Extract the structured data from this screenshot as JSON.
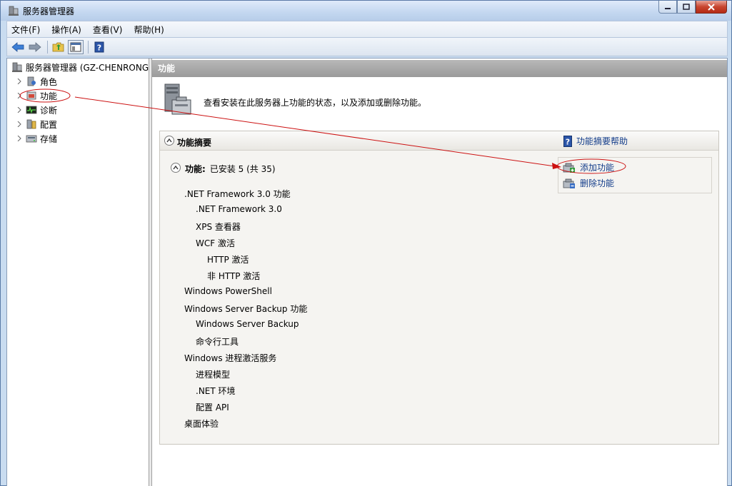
{
  "window": {
    "title": "服务器管理器"
  },
  "menu": [
    "文件(F)",
    "操作(A)",
    "查看(V)",
    "帮助(H)"
  ],
  "toolbar": {
    "icons": [
      "back-arrow-icon",
      "forward-arrow-icon",
      "up-folder-icon",
      "show-hide-pane-icon",
      "help-icon"
    ]
  },
  "tree": {
    "root": "服务器管理器 (GZ-CHENRONG",
    "items": [
      {
        "label": "角色",
        "icon": "roles-icon"
      },
      {
        "label": "功能",
        "icon": "features-icon"
      },
      {
        "label": "诊断",
        "icon": "diagnostics-icon"
      },
      {
        "label": "配置",
        "icon": "configuration-icon"
      },
      {
        "label": "存储",
        "icon": "storage-icon"
      }
    ]
  },
  "content": {
    "header": "功能",
    "description": "查看安装在此服务器上功能的状态，以及添加或删除功能。",
    "summary": {
      "title": "功能摘要",
      "help_link": "功能摘要帮助",
      "features_label": "功能:",
      "features_value": "已安装 5 (共 35)",
      "actions": [
        {
          "label": "添加功能",
          "icon": "add-feature-icon"
        },
        {
          "label": "删除功能",
          "icon": "remove-feature-icon"
        }
      ],
      "installed": [
        {
          "name": ".NET Framework 3.0 功能",
          "level": 0
        },
        {
          "name": ".NET Framework 3.0",
          "level": 1
        },
        {
          "name": "XPS 查看器",
          "level": 1
        },
        {
          "name": "WCF 激活",
          "level": 1
        },
        {
          "name": "HTTP 激活",
          "level": 2
        },
        {
          "name": "非 HTTP 激活",
          "level": 2
        },
        {
          "name": "Windows PowerShell",
          "level": 0
        },
        {
          "name": "Windows Server Backup 功能",
          "level": 0
        },
        {
          "name": "Windows Server Backup",
          "level": 1
        },
        {
          "name": "命令行工具",
          "level": 1
        },
        {
          "name": "Windows 进程激活服务",
          "level": 0
        },
        {
          "name": "进程模型",
          "level": 1
        },
        {
          "name": ".NET 环境",
          "level": 1
        },
        {
          "name": "配置 API",
          "level": 1
        },
        {
          "name": "桌面体验",
          "level": 0
        }
      ]
    }
  },
  "colors": {
    "link": "#123c8a",
    "annotation": "#cc1111",
    "header_bg": "#a6a6a6"
  }
}
